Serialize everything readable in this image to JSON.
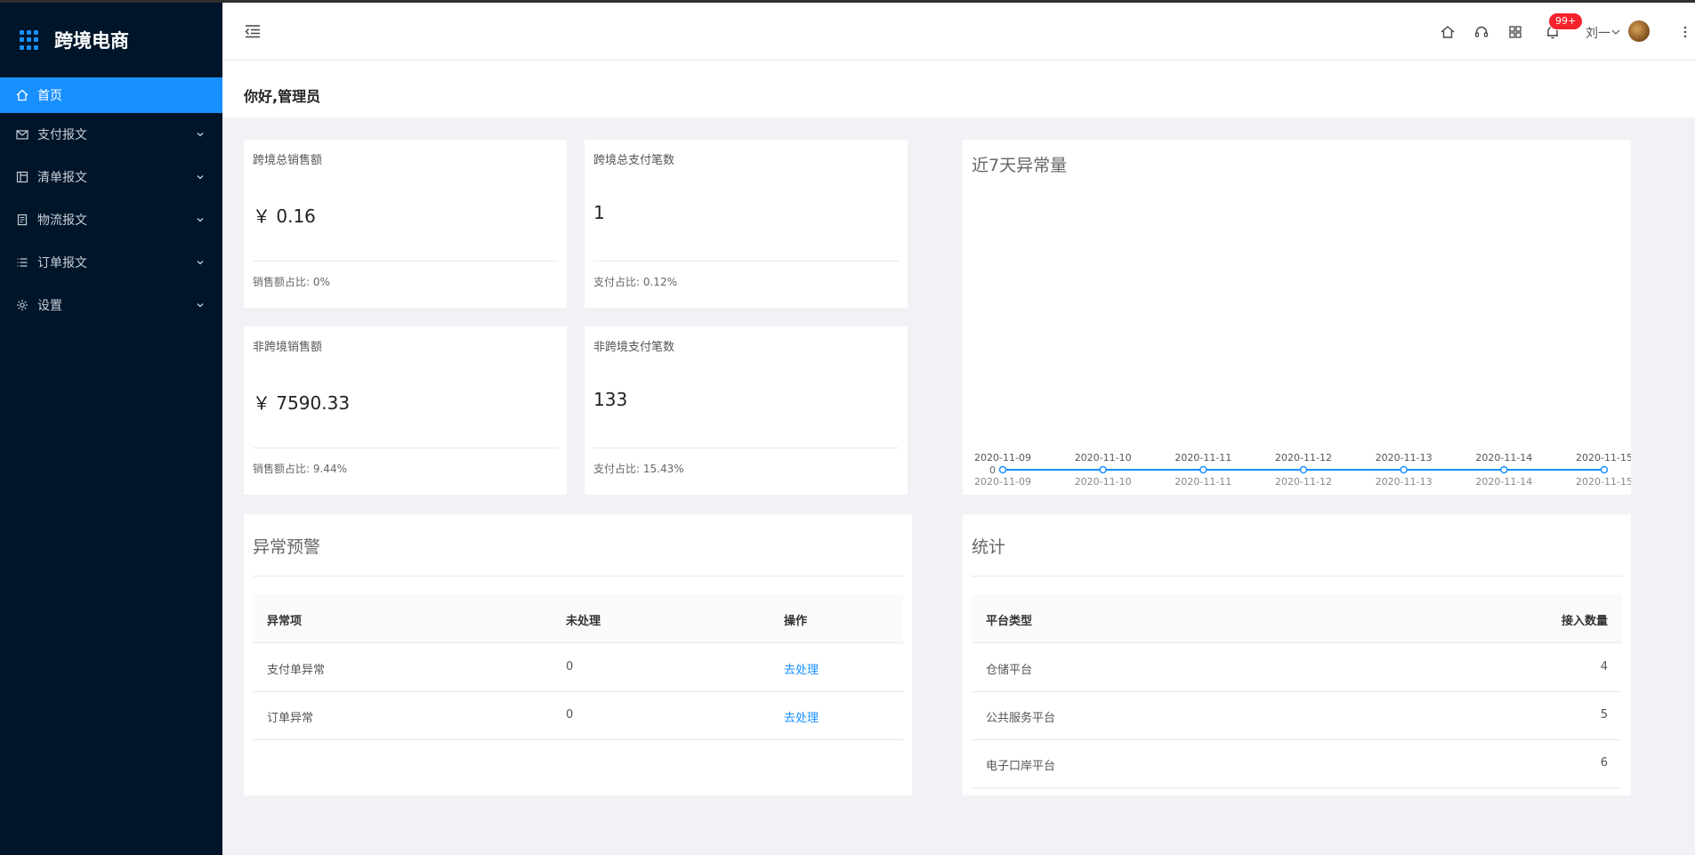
{
  "app": {
    "title": "跨境电商"
  },
  "sidebar": {
    "items": [
      {
        "label": "首页",
        "icon": "home-icon",
        "active": true
      },
      {
        "label": "支付报文",
        "icon": "mail-icon"
      },
      {
        "label": "清单报文",
        "icon": "layout-icon"
      },
      {
        "label": "物流报文",
        "icon": "file-icon"
      },
      {
        "label": "订单报文",
        "icon": "list-icon"
      },
      {
        "label": "设置",
        "icon": "gear-icon"
      }
    ]
  },
  "header": {
    "icons": [
      "home-icon",
      "headset-icon",
      "apps-icon",
      "bell-icon"
    ],
    "notification_badge": "99+",
    "user_name": "刘一"
  },
  "greeting": "你好,管理员",
  "stats": [
    {
      "label": "跨境总销售额",
      "value": "￥ 0.16",
      "foot": "销售额占比: 0%"
    },
    {
      "label": "跨境总支付笔数",
      "value": "1",
      "foot": "支付占比: 0.12%"
    },
    {
      "label": "非跨境销售额",
      "value": "￥ 7590.33",
      "foot": "销售额占比: 9.44%"
    },
    {
      "label": "非跨境支付笔数",
      "value": "133",
      "foot": "支付占比: 15.43%"
    }
  ],
  "chart_data": {
    "type": "line",
    "title": "近7天异常量",
    "x": [
      "2020-11-09",
      "2020-11-10",
      "2020-11-11",
      "2020-11-12",
      "2020-11-13",
      "2020-11-14",
      "2020-11-15"
    ],
    "series": [
      {
        "values": [
          0,
          0,
          0,
          0,
          0,
          0,
          0
        ]
      }
    ],
    "y_tick_labels": [
      "0"
    ],
    "color": "#1890ff"
  },
  "alerts": {
    "title": "异常预警",
    "columns": [
      "异常项",
      "未处理",
      "操作"
    ],
    "rows": [
      {
        "item": "支付单异常",
        "pending": "0",
        "action": "去处理"
      },
      {
        "item": "订单异常",
        "pending": "0",
        "action": "去处理"
      }
    ]
  },
  "stats_table": {
    "title": "统计",
    "columns": [
      "平台类型",
      "接入数量"
    ],
    "rows": [
      {
        "type": "仓储平台",
        "count": "4"
      },
      {
        "type": "公共服务平台",
        "count": "5"
      },
      {
        "type": "电子口岸平台",
        "count": "6"
      }
    ]
  },
  "colors": {
    "sidebar_bg": "#001529",
    "accent": "#1890ff",
    "badge": "#f5222d"
  }
}
